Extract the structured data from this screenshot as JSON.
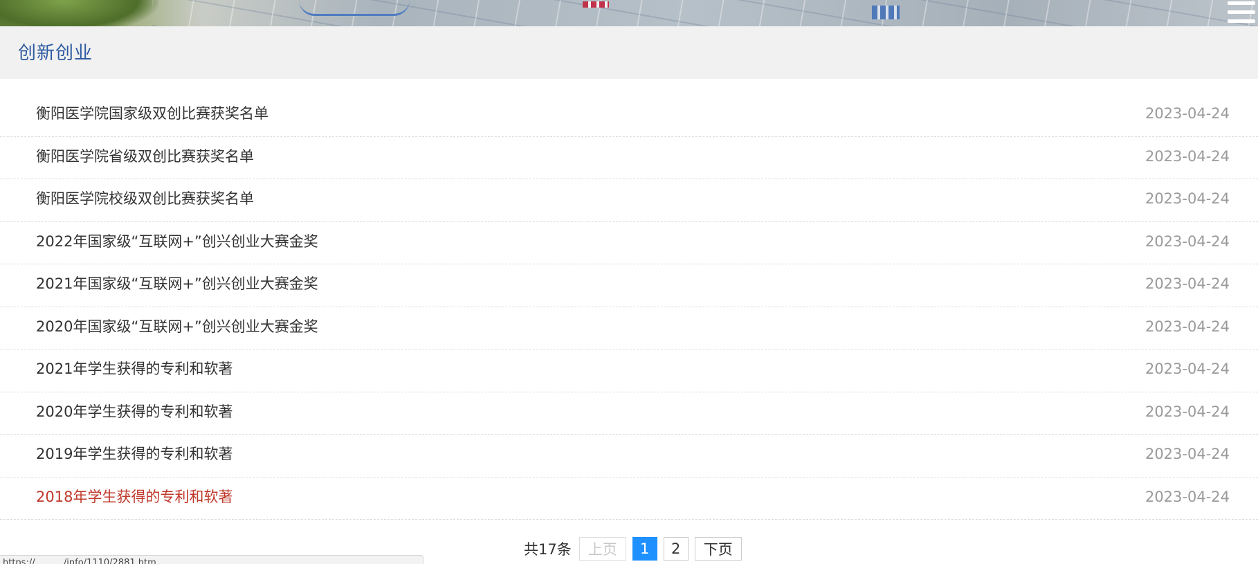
{
  "banner": {
    "icon": "campus-photo-banner"
  },
  "menu": {
    "icon": "hamburger-menu-icon"
  },
  "section": {
    "title": "创新创业"
  },
  "news": [
    {
      "title": "衡阳医学院国家级双创比赛获奖名单",
      "date": "2023-04-24"
    },
    {
      "title": "衡阳医学院省级双创比赛获奖名单",
      "date": "2023-04-24"
    },
    {
      "title": "衡阳医学院校级双创比赛获奖名单",
      "date": "2023-04-24"
    },
    {
      "title": "2022年国家级“互联网+”创兴创业大赛金奖",
      "date": "2023-04-24"
    },
    {
      "title": "2021年国家级“互联网+”创兴创业大赛金奖",
      "date": "2023-04-24"
    },
    {
      "title": "2020年国家级“互联网+”创兴创业大赛金奖",
      "date": "2023-04-24"
    },
    {
      "title": "2021年学生获得的专利和软著",
      "date": "2023-04-24"
    },
    {
      "title": "2020年学生获得的专利和软著",
      "date": "2023-04-24"
    },
    {
      "title": "2019年学生获得的专利和软著",
      "date": "2023-04-24"
    },
    {
      "title": "2018年学生获得的专利和软著",
      "date": "2023-04-24"
    }
  ],
  "colors": {
    "accent": "#2c5aa0",
    "hover_link": "#c0392b",
    "current_page": "#1e90ff"
  },
  "pager": {
    "total": "共17条",
    "prev": "上页",
    "page1": "1",
    "page2": "2",
    "next": "下页"
  },
  "status": {
    "url": "https://........../info/1110/2881.htm"
  }
}
